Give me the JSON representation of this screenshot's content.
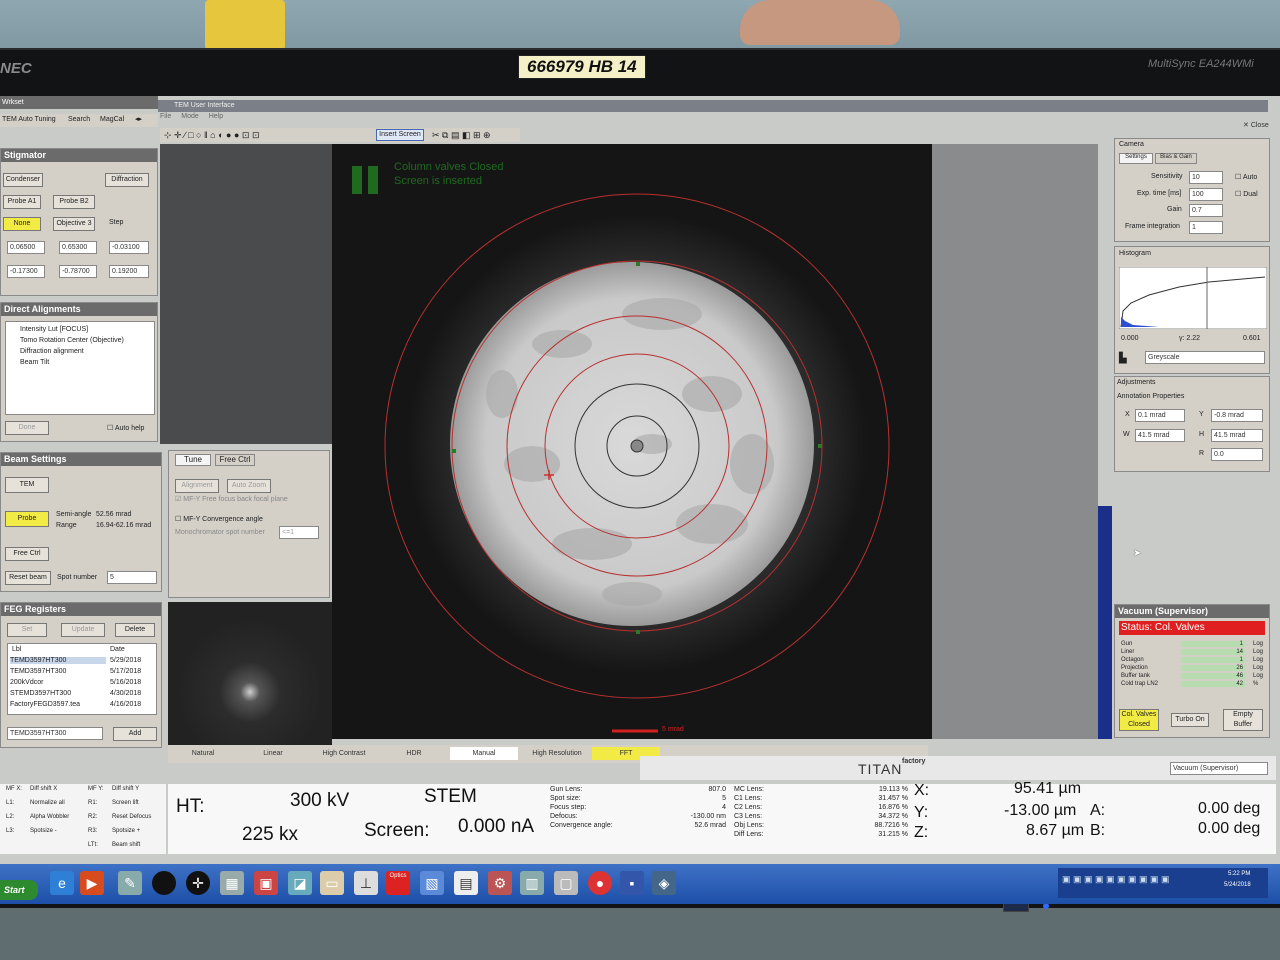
{
  "sticker": "666979 HB 14",
  "monitor": {
    "brand": "NEC",
    "model": "MultiSync EA244WMi"
  },
  "window": {
    "title": "TEM User Interface",
    "menus": [
      "File",
      "Mode",
      "Help"
    ],
    "close_label": "Close",
    "toolbar_insert": "Insert Screen"
  },
  "left_tabs": [
    "TEM Auto Tuning",
    "Search",
    "MagCal"
  ],
  "left_title": "Wrkset",
  "stigmator": {
    "title": "Stigmator",
    "condenser": "Condenser",
    "diffraction": "Diffraction",
    "probe_a1": "Probe A1",
    "probe_b2": "Probe B2",
    "none": "None",
    "objective": "Objective 3",
    "step": "Step",
    "x_values": [
      "0.06500",
      "0.65300",
      "-0.03100"
    ],
    "y_values": [
      "-0.17300",
      "-0.78700",
      "0.19200"
    ]
  },
  "direct_alignments": {
    "title": "Direct Alignments",
    "items": [
      "Intensity Lut [FOCUS]",
      "Tomo Rotation Center (Objective)",
      "Diffraction alignment",
      "Beam Tilt"
    ],
    "done": "Done",
    "auto_help": "Auto help"
  },
  "beam_settings": {
    "title": "Beam Settings",
    "tem": "TEM",
    "probe": "Probe",
    "semi_angle_label": "Semi-angle",
    "semi_angle": "52.56 mrad",
    "range_label": "Range",
    "range": "16.94-62.16 mrad",
    "free_ctrl": "Free Ctrl",
    "reset_beam": "Reset beam",
    "spot_number_label": "Spot number",
    "spot_number": "5"
  },
  "tune": {
    "tabs": [
      "Tune",
      "Free Ctrl"
    ],
    "btn1": "Alignment",
    "btn2": "Auto Zoom",
    "mfy_free": "MF-Y Free focus back focal plane",
    "mfy_conv": "MF-Y Convergence angle",
    "mono_label": "Monochromator spot number",
    "mono_value": "<=1"
  },
  "feg": {
    "title": "FEG Registers",
    "set": "Set",
    "update": "Update",
    "delete": "Delete",
    "columns": [
      "Lbl",
      "Date"
    ],
    "rows": [
      {
        "lbl": "TEMD3597HT300",
        "date": "5/29/2018"
      },
      {
        "lbl": "TEMD3597HT300",
        "date": "5/17/2018"
      },
      {
        "lbl": "200kVdcor",
        "date": "5/16/2018"
      },
      {
        "lbl": "STEMD3597HT300",
        "date": "4/30/2018"
      },
      {
        "lbl": "FactoryFEGD3597.tea",
        "date": "4/16/2018"
      }
    ],
    "input": "TEMD3597HT300",
    "add": "Add"
  },
  "overlay": {
    "line1": "Column valves Closed",
    "line2": "Screen is inserted"
  },
  "scale_label": "5 mrad",
  "display_tabs": [
    "Natural",
    "Linear",
    "High Contrast",
    "HDR",
    "Manual",
    "High Resolution",
    "FFT"
  ],
  "camera": {
    "title": "Camera",
    "tabs": [
      "Settings",
      "Bias & Gain"
    ],
    "rows": [
      {
        "label": "Sensitivity",
        "value": "10"
      },
      {
        "label": "Exp. time [ms]",
        "value": "100"
      },
      {
        "label": "Gain",
        "value": "0.7"
      },
      {
        "label": "Frame integration",
        "value": "1"
      }
    ],
    "auto": "Auto",
    "dual": "Dual"
  },
  "histogram": {
    "title": "Histogram",
    "min": "0.000",
    "gamma": "γ: 2.22",
    "max": "0.601",
    "palette": "Greyscale"
  },
  "adjustments": {
    "title": "Adjustments",
    "annot": "Annotation Properties",
    "x": "0.1 mrad",
    "y": "-0.8 mrad",
    "w": "41.5 mrad",
    "h": "41.5 mrad",
    "r": "0.0"
  },
  "vacuum": {
    "title": "Vacuum (Supervisor)",
    "status": "Status: Col. Valves",
    "rows": [
      {
        "label": "Gun",
        "value": "1",
        "unit": "Log"
      },
      {
        "label": "Liner",
        "value": "14",
        "unit": "Log"
      },
      {
        "label": "Octagon",
        "value": "1",
        "unit": "Log"
      },
      {
        "label": "Projection",
        "value": "26",
        "unit": "Log"
      },
      {
        "label": "Buffer tank",
        "value": "46",
        "unit": "Log"
      },
      {
        "label": "Cold trap LN2",
        "value": "42",
        "unit": "%"
      }
    ],
    "col_valves": "Col. Valves Closed",
    "turbo": "Turbo On",
    "empty_buffer": "Empty Buffer"
  },
  "titan": {
    "name": "TITAN",
    "sub": "factory"
  },
  "vacuum_select": "Vacuum (Supervisor)",
  "mf_keys": [
    {
      "key": "MF X:",
      "val": "Diff shift X",
      "key2": "MF Y:",
      "val2": "Diff shift Y"
    },
    {
      "key": "L1:",
      "val": "Normalize all",
      "key2": "R1:",
      "val2": "Screen lift"
    },
    {
      "key": "L2:",
      "val": "Alpha Wobbler",
      "key2": "R2:",
      "val2": "Reset Defocus"
    },
    {
      "key": "L3:",
      "val": "Spotsize -",
      "key2": "R3:",
      "val2": "Spotsize +"
    },
    {
      "key": "",
      "val": "",
      "key2": "LTt:",
      "val2": "Beam shift"
    }
  ],
  "status": {
    "ht_label": "HT:",
    "ht": "300 kV",
    "mode": "STEM",
    "mag": "225 kx",
    "screen_label": "Screen:",
    "screen": "0.000 nA",
    "lenses": [
      {
        "label": "Gun Lens:",
        "value": "807.0",
        "label2": "MC Lens:",
        "value2": "19.113 %"
      },
      {
        "label": "Spot size:",
        "value": "5",
        "label2": "C1 Lens:",
        "value2": "31.457 %"
      },
      {
        "label": "Focus step:",
        "value": "4",
        "label2": "C2 Lens:",
        "value2": "16.876 %"
      },
      {
        "label": "Defocus:",
        "value": "-130.00 nm",
        "label2": "C3 Lens:",
        "value2": "34.372 %"
      },
      {
        "label": "Convergence angle:",
        "value": "52.6 mrad",
        "label2": "Obj Lens:",
        "value2": "88.7216 %"
      },
      {
        "label": "",
        "value": "",
        "label2": "Diff Lens:",
        "value2": "31.215 %"
      }
    ],
    "x_label": "X:",
    "x": "95.41 µm",
    "y_label": "Y:",
    "y": "-13.00 µm",
    "a_label": "A:",
    "a": "0.00 deg",
    "z_label": "Z:",
    "z": "8.67 µm",
    "b_label": "B:",
    "b": "0.00 deg"
  },
  "taskbar": {
    "start": "Start",
    "time": "5:22 PM",
    "date": "5/24/2018",
    "optics": "Optics"
  }
}
